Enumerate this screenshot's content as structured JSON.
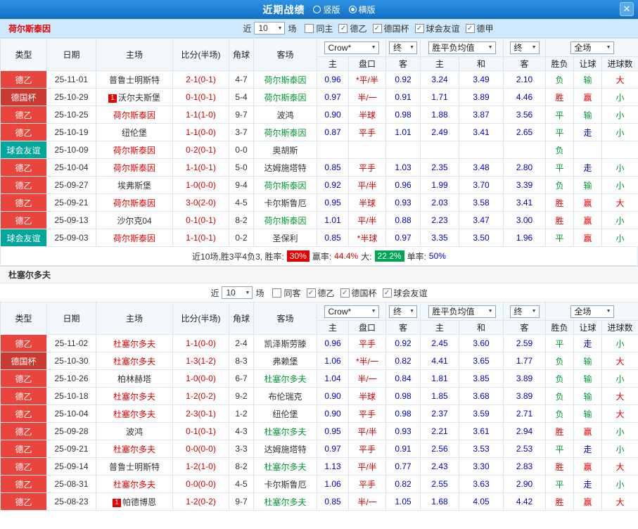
{
  "titlebar": {
    "title": "近期战绩",
    "layout_options": [
      {
        "label": "竖版",
        "selected": false
      },
      {
        "label": "横版",
        "selected": true
      }
    ],
    "close_icon": "✕"
  },
  "columns": {
    "type": "类型",
    "date": "日期",
    "home": "主场",
    "score": "比分(半场)",
    "corner": "角球",
    "away": "客场",
    "sub_odds_home": "主",
    "sub_odds_line": "盘口",
    "sub_odds_away": "客",
    "sub_avg_home": "主",
    "sub_avg_draw": "和",
    "sub_avg_away": "客",
    "sub_result": "胜负",
    "sub_handicap": "让球",
    "sub_goals": "进球数",
    "dropdown_odds_provider": "Crow*",
    "dropdown_final_odds": "终",
    "dropdown_avg": "胜平负均值",
    "dropdown_final_avg": "终",
    "dropdown_scope": "全场"
  },
  "league_colors": {
    "德乙": "#e8463c",
    "德国杯": "#cb3a31",
    "球会友谊": "#00a79a"
  },
  "palette": {
    "titlebar_bg": "#1b7fd4",
    "team_bar_bg": "#cfe8fb",
    "win_red": "#e60000",
    "lose_green": "#009933",
    "neutral_blue": "#0000dd",
    "odds_blue": "#0000cc",
    "score_red": "#d60000"
  },
  "sections": [
    {
      "team": "荷尔斯泰因",
      "filter": {
        "near_label": "近",
        "count": "10",
        "games_label": "场",
        "checks": [
          {
            "label": "同主",
            "checked": false
          },
          {
            "label": "德乙",
            "checked": true
          },
          {
            "label": "德国杯",
            "checked": true
          },
          {
            "label": "球会友谊",
            "checked": true
          },
          {
            "label": "德甲",
            "checked": true
          }
        ]
      },
      "rows": [
        {
          "league": "德乙",
          "date": "25-11-01",
          "home": {
            "text": "普鲁士明斯特",
            "color": "black"
          },
          "score": "2-1(0-1)",
          "corner": "4-7",
          "away": {
            "text": "荷尔斯泰因",
            "color": "green"
          },
          "odds": [
            "0.96",
            "*平/半",
            "0.92"
          ],
          "avg": [
            "3.24",
            "3.49",
            "2.10"
          ],
          "results": [
            [
              "负",
              "green"
            ],
            [
              "输",
              "green"
            ],
            [
              "大",
              "red"
            ]
          ]
        },
        {
          "league": "德国杯",
          "date": "25-10-29",
          "home": {
            "text": "沃尔夫斯堡",
            "color": "black",
            "badge": "1"
          },
          "score": "0-1(0-1)",
          "corner": "5-4",
          "away": {
            "text": "荷尔斯泰因",
            "color": "green"
          },
          "odds": [
            "0.97",
            "半/一",
            "0.91"
          ],
          "avg": [
            "1.71",
            "3.89",
            "4.46"
          ],
          "results": [
            [
              "胜",
              "red"
            ],
            [
              "赢",
              "red"
            ],
            [
              "小",
              "green"
            ]
          ]
        },
        {
          "league": "德乙",
          "date": "25-10-25",
          "home": {
            "text": "荷尔斯泰因",
            "color": "red"
          },
          "score": "1-1(1-0)",
          "corner": "9-7",
          "away": {
            "text": "波鸿",
            "color": "black"
          },
          "odds": [
            "0.90",
            "半球",
            "0.98"
          ],
          "avg": [
            "1.88",
            "3.87",
            "3.56"
          ],
          "results": [
            [
              "平",
              "green"
            ],
            [
              "输",
              "green"
            ],
            [
              "小",
              "green"
            ]
          ]
        },
        {
          "league": "德乙",
          "date": "25-10-19",
          "home": {
            "text": "纽伦堡",
            "color": "black"
          },
          "score": "1-1(0-0)",
          "corner": "3-7",
          "away": {
            "text": "荷尔斯泰因",
            "color": "green"
          },
          "odds": [
            "0.87",
            "平手",
            "1.01"
          ],
          "avg": [
            "2.49",
            "3.41",
            "2.65"
          ],
          "results": [
            [
              "平",
              "green"
            ],
            [
              "走",
              "blue"
            ],
            [
              "小",
              "green"
            ]
          ]
        },
        {
          "league": "球会友谊",
          "date": "25-10-09",
          "home": {
            "text": "荷尔斯泰因",
            "color": "red"
          },
          "score": "0-2(0-1)",
          "corner": "0-0",
          "away": {
            "text": "奥胡斯",
            "color": "black"
          },
          "odds": [
            "",
            "",
            ""
          ],
          "avg": [
            "",
            "",
            ""
          ],
          "results": [
            [
              "负",
              "green"
            ],
            [
              "",
              ""
            ],
            [
              "",
              ""
            ]
          ]
        },
        {
          "league": "德乙",
          "date": "25-10-04",
          "home": {
            "text": "荷尔斯泰因",
            "color": "red"
          },
          "score": "1-1(0-1)",
          "corner": "5-0",
          "away": {
            "text": "达姆施塔特",
            "color": "black"
          },
          "odds": [
            "0.85",
            "平手",
            "1.03"
          ],
          "avg": [
            "2.35",
            "3.48",
            "2.80"
          ],
          "results": [
            [
              "平",
              "green"
            ],
            [
              "走",
              "blue"
            ],
            [
              "小",
              "green"
            ]
          ]
        },
        {
          "league": "德乙",
          "date": "25-09-27",
          "home": {
            "text": "埃弗斯堡",
            "color": "black"
          },
          "score": "1-0(0-0)",
          "corner": "9-4",
          "away": {
            "text": "荷尔斯泰因",
            "color": "green"
          },
          "odds": [
            "0.92",
            "平/半",
            "0.96"
          ],
          "avg": [
            "1.99",
            "3.70",
            "3.39"
          ],
          "results": [
            [
              "负",
              "green"
            ],
            [
              "输",
              "green"
            ],
            [
              "小",
              "green"
            ]
          ]
        },
        {
          "league": "德乙",
          "date": "25-09-21",
          "home": {
            "text": "荷尔斯泰因",
            "color": "red"
          },
          "score": "3-0(2-0)",
          "corner": "4-5",
          "away": {
            "text": "卡尔斯鲁厄",
            "color": "black"
          },
          "odds": [
            "0.95",
            "半球",
            "0.93"
          ],
          "avg": [
            "2.03",
            "3.58",
            "3.41"
          ],
          "results": [
            [
              "胜",
              "red"
            ],
            [
              "赢",
              "red"
            ],
            [
              "大",
              "red"
            ]
          ]
        },
        {
          "league": "德乙",
          "date": "25-09-13",
          "home": {
            "text": "沙尔克04",
            "color": "black"
          },
          "score": "0-1(0-1)",
          "corner": "8-2",
          "away": {
            "text": "荷尔斯泰因",
            "color": "green"
          },
          "odds": [
            "1.01",
            "平/半",
            "0.88"
          ],
          "avg": [
            "2.23",
            "3.47",
            "3.00"
          ],
          "results": [
            [
              "胜",
              "red"
            ],
            [
              "赢",
              "red"
            ],
            [
              "小",
              "green"
            ]
          ]
        },
        {
          "league": "球会友谊",
          "date": "25-09-03",
          "home": {
            "text": "荷尔斯泰因",
            "color": "red"
          },
          "score": "1-1(0-1)",
          "corner": "0-2",
          "away": {
            "text": "圣保利",
            "color": "black"
          },
          "odds": [
            "0.85",
            "*半球",
            "0.97"
          ],
          "avg": [
            "3.35",
            "3.50",
            "1.96"
          ],
          "results": [
            [
              "平",
              "green"
            ],
            [
              "赢",
              "red"
            ],
            [
              "小",
              "green"
            ]
          ]
        }
      ],
      "summary": {
        "prefix": "近10场,胜3平4负3, 胜率:",
        "win_rate": "30%",
        "label_win2": "赢率:",
        "win2_rate": "44.4%",
        "label_big": "大:",
        "big_rate": "22.2%",
        "label_single": "单率:",
        "single_rate": "50%"
      }
    },
    {
      "team": "杜塞尔多夫",
      "filter": {
        "near_label": "近",
        "count": "10",
        "games_label": "场",
        "checks": [
          {
            "label": "同客",
            "checked": false
          },
          {
            "label": "德乙",
            "checked": true
          },
          {
            "label": "德国杯",
            "checked": true
          },
          {
            "label": "球会友谊",
            "checked": true
          }
        ]
      },
      "rows": [
        {
          "league": "德乙",
          "date": "25-11-02",
          "home": {
            "text": "杜塞尔多夫",
            "color": "red"
          },
          "score": "1-1(0-0)",
          "corner": "2-4",
          "away": {
            "text": "凯泽斯劳滕",
            "color": "black"
          },
          "odds": [
            "0.96",
            "平手",
            "0.92"
          ],
          "avg": [
            "2.45",
            "3.60",
            "2.59"
          ],
          "results": [
            [
              "平",
              "green"
            ],
            [
              "走",
              "blue"
            ],
            [
              "小",
              "green"
            ]
          ]
        },
        {
          "league": "德国杯",
          "date": "25-10-30",
          "home": {
            "text": "杜塞尔多夫",
            "color": "red"
          },
          "score": "1-3(1-2)",
          "corner": "8-3",
          "away": {
            "text": "弗赖堡",
            "color": "black"
          },
          "odds": [
            "1.06",
            "*半/一",
            "0.82"
          ],
          "avg": [
            "4.41",
            "3.65",
            "1.77"
          ],
          "results": [
            [
              "负",
              "green"
            ],
            [
              "输",
              "green"
            ],
            [
              "大",
              "red"
            ]
          ]
        },
        {
          "league": "德乙",
          "date": "25-10-26",
          "home": {
            "text": "柏林赫塔",
            "color": "black"
          },
          "score": "1-0(0-0)",
          "corner": "6-7",
          "away": {
            "text": "杜塞尔多夫",
            "color": "green"
          },
          "odds": [
            "1.04",
            "半/一",
            "0.84"
          ],
          "avg": [
            "1.81",
            "3.85",
            "3.89"
          ],
          "results": [
            [
              "负",
              "green"
            ],
            [
              "输",
              "green"
            ],
            [
              "小",
              "green"
            ]
          ]
        },
        {
          "league": "德乙",
          "date": "25-10-18",
          "home": {
            "text": "杜塞尔多夫",
            "color": "red"
          },
          "score": "1-2(0-2)",
          "corner": "9-2",
          "away": {
            "text": "布伦瑞克",
            "color": "black"
          },
          "odds": [
            "0.90",
            "半球",
            "0.98"
          ],
          "avg": [
            "1.85",
            "3.68",
            "3.89"
          ],
          "results": [
            [
              "负",
              "green"
            ],
            [
              "输",
              "green"
            ],
            [
              "大",
              "red"
            ]
          ]
        },
        {
          "league": "德乙",
          "date": "25-10-04",
          "home": {
            "text": "杜塞尔多夫",
            "color": "red"
          },
          "score": "2-3(0-1)",
          "corner": "1-2",
          "away": {
            "text": "纽伦堡",
            "color": "black"
          },
          "odds": [
            "0.90",
            "平手",
            "0.98"
          ],
          "avg": [
            "2.37",
            "3.59",
            "2.71"
          ],
          "results": [
            [
              "负",
              "green"
            ],
            [
              "输",
              "green"
            ],
            [
              "大",
              "red"
            ]
          ]
        },
        {
          "league": "德乙",
          "date": "25-09-28",
          "home": {
            "text": "波鸿",
            "color": "black"
          },
          "score": "0-1(0-1)",
          "corner": "4-3",
          "away": {
            "text": "杜塞尔多夫",
            "color": "green"
          },
          "odds": [
            "0.95",
            "平/半",
            "0.93"
          ],
          "avg": [
            "2.21",
            "3.61",
            "2.94"
          ],
          "results": [
            [
              "胜",
              "red"
            ],
            [
              "赢",
              "red"
            ],
            [
              "小",
              "green"
            ]
          ]
        },
        {
          "league": "德乙",
          "date": "25-09-21",
          "home": {
            "text": "杜塞尔多夫",
            "color": "red"
          },
          "score": "0-0(0-0)",
          "corner": "3-3",
          "away": {
            "text": "达姆施塔特",
            "color": "black"
          },
          "odds": [
            "0.97",
            "平手",
            "0.91"
          ],
          "avg": [
            "2.56",
            "3.53",
            "2.53"
          ],
          "results": [
            [
              "平",
              "green"
            ],
            [
              "走",
              "blue"
            ],
            [
              "小",
              "green"
            ]
          ]
        },
        {
          "league": "德乙",
          "date": "25-09-14",
          "home": {
            "text": "普鲁士明斯特",
            "color": "black"
          },
          "score": "1-2(1-0)",
          "corner": "8-2",
          "away": {
            "text": "杜塞尔多夫",
            "color": "green"
          },
          "odds": [
            "1.13",
            "平/半",
            "0.77"
          ],
          "avg": [
            "2.43",
            "3.30",
            "2.83"
          ],
          "results": [
            [
              "胜",
              "red"
            ],
            [
              "赢",
              "red"
            ],
            [
              "大",
              "red"
            ]
          ]
        },
        {
          "league": "德乙",
          "date": "25-08-31",
          "home": {
            "text": "杜塞尔多夫",
            "color": "red"
          },
          "score": "0-0(0-0)",
          "corner": "4-5",
          "away": {
            "text": "卡尔斯鲁厄",
            "color": "black"
          },
          "odds": [
            "1.06",
            "平手",
            "0.82"
          ],
          "avg": [
            "2.55",
            "3.63",
            "2.90"
          ],
          "results": [
            [
              "平",
              "green"
            ],
            [
              "走",
              "blue"
            ],
            [
              "小",
              "green"
            ]
          ]
        },
        {
          "league": "德乙",
          "date": "25-08-23",
          "home": {
            "text": "帕德博恩",
            "color": "black",
            "badge": "1"
          },
          "score": "1-2(0-2)",
          "corner": "9-7",
          "away": {
            "text": "杜塞尔多夫",
            "color": "green"
          },
          "odds": [
            "0.85",
            "半/一",
            "1.05"
          ],
          "avg": [
            "1.68",
            "4.05",
            "4.42"
          ],
          "results": [
            [
              "胜",
              "red"
            ],
            [
              "赢",
              "red"
            ],
            [
              "大",
              "red"
            ]
          ]
        }
      ]
    }
  ]
}
